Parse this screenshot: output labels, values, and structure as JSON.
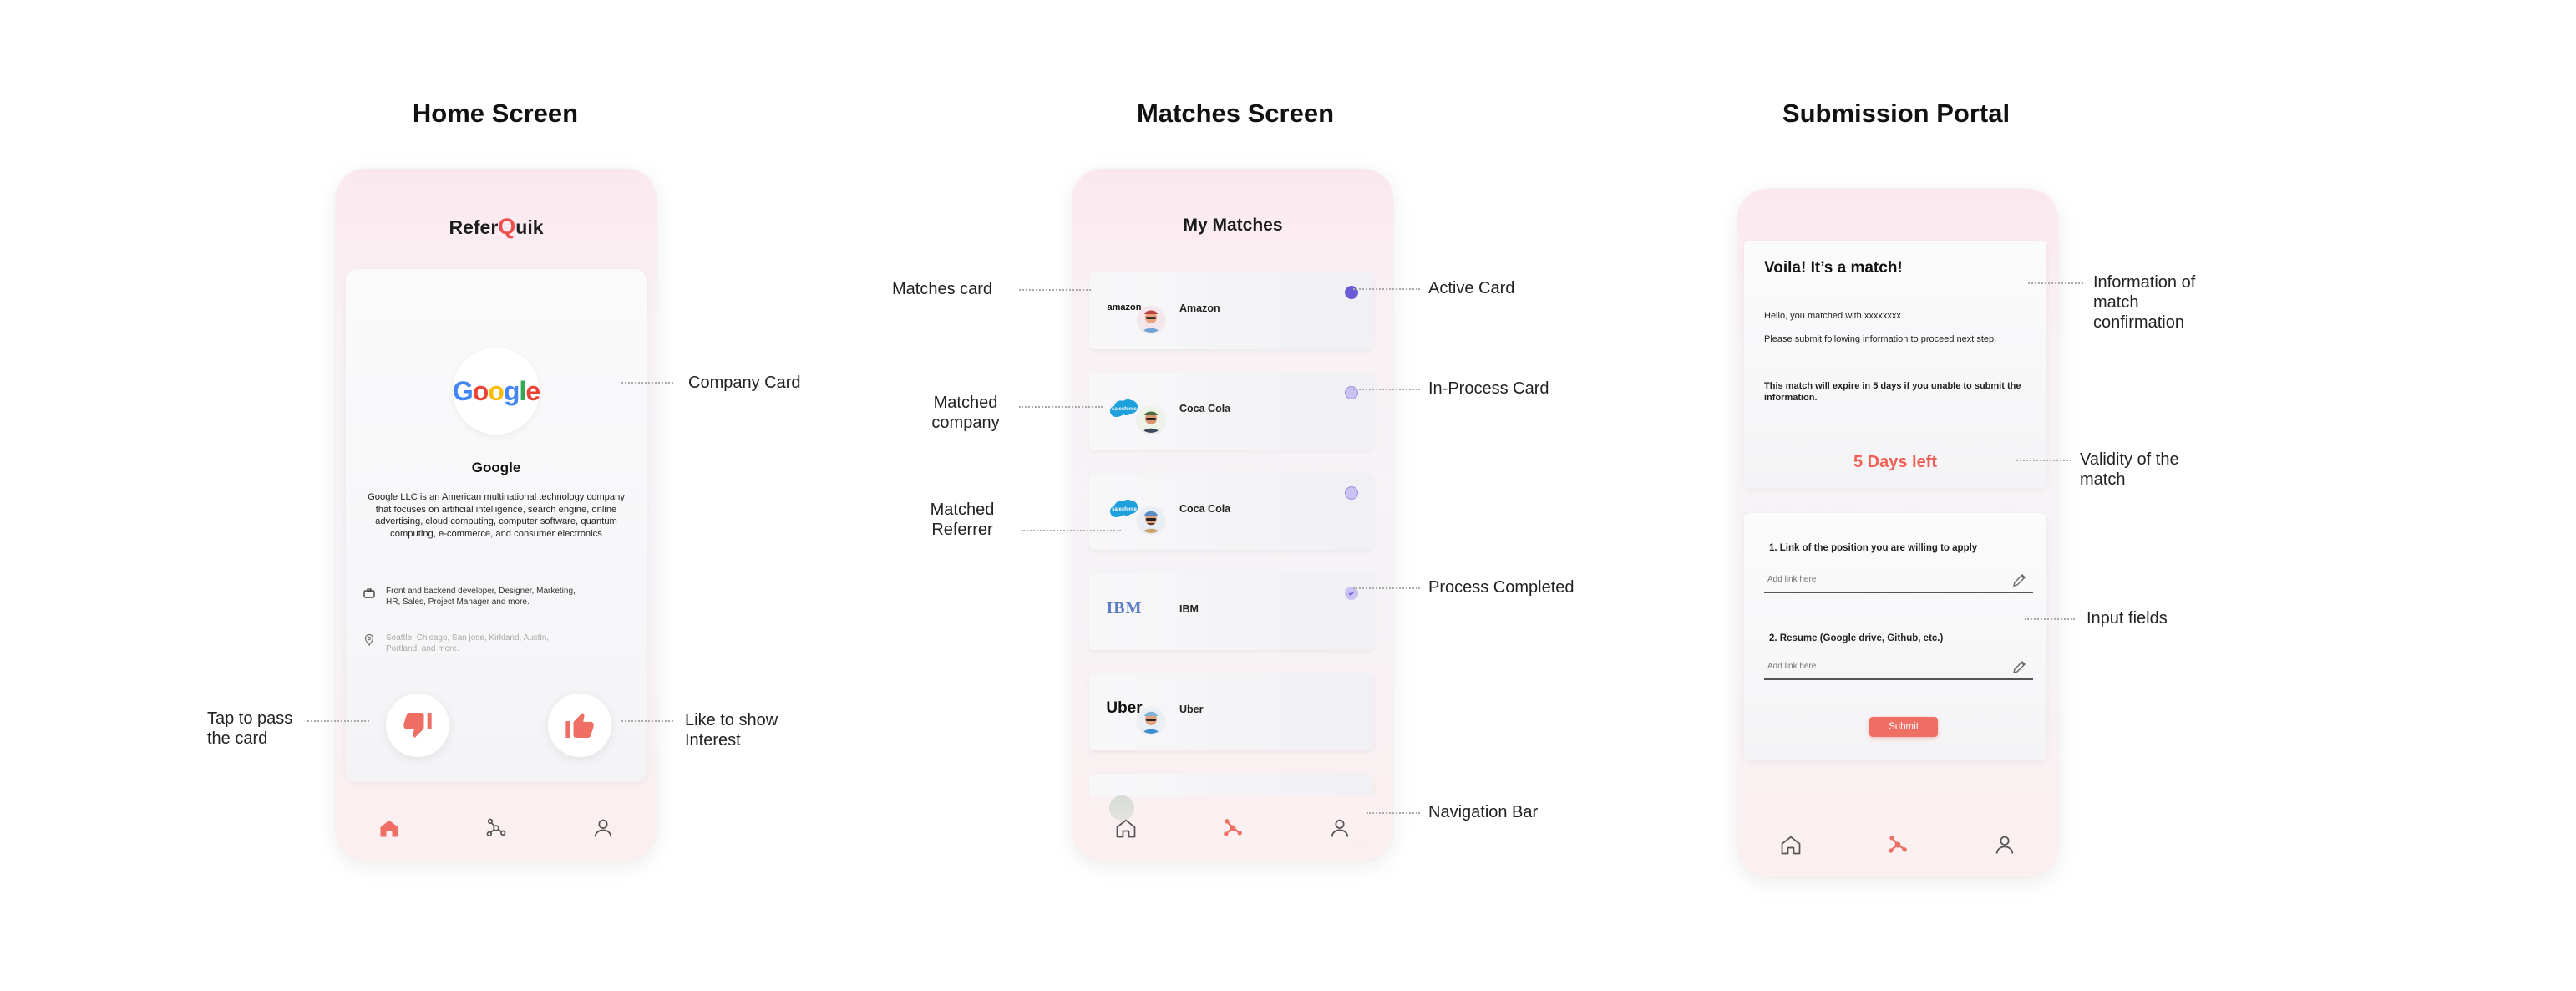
{
  "titles": {
    "home": "Home Screen",
    "matches": "Matches Screen",
    "submission": "Submission Portal"
  },
  "home": {
    "logo_prefix": "Refer",
    "logo_q": "Q",
    "logo_suffix": "uik",
    "company_name": "Google",
    "logo_text": "Google",
    "description": "Google LLC is an American multinational technology company that focuses on artificial intelligence, search engine, online advertising, cloud computing, computer software, quantum computing, e-commerce, and consumer electronics",
    "roles": "Front and backend developer, Designer, Marketing, HR, Sales, Project Manager and more.",
    "locations": "Seattle, Chicago, San jose, Kirkland, Austin, Portland, and more.",
    "annotations": {
      "company_card": "Company Card",
      "pass": "Tap to pass the card",
      "like": "Like to show Interest"
    }
  },
  "matches": {
    "title": "My Matches",
    "cards": [
      {
        "company": "Amazon",
        "logo": "amazon",
        "status": "active"
      },
      {
        "company": "Coca Cola",
        "logo": "salesforce",
        "status": "in-process"
      },
      {
        "company": "Coca Cola",
        "logo": "salesforce",
        "status": "in-process"
      },
      {
        "company": "IBM",
        "logo": "IBM",
        "status": "completed"
      },
      {
        "company": "Uber",
        "logo": "Uber",
        "status": "none"
      }
    ],
    "annotations": {
      "matches_card": "Matches card",
      "matched_company": "Matched company",
      "matched_referrer": "Matched Referrer",
      "active_card": "Active Card",
      "in_process_card": "In-Process Card",
      "process_completed": "Process Completed",
      "navigation_bar": "Navigation Bar"
    },
    "colors": {
      "active": "#6a5cd6",
      "in_process": "#c9c2f2",
      "completed": "#c9c2f2"
    }
  },
  "submission": {
    "title": "Voila! It’s a match!",
    "hello": "Hello, you matched with xxxxxxxx",
    "instruction": "Please submit following information to proceed next step.",
    "warning": "This match will expire in 5 days if you unable to submit the information.",
    "days_left": "5 Days left",
    "q1": "1.  Link of the position you are willing to apply",
    "q2": "2.  Resume (Google drive, Github, etc.)",
    "placeholder1": "Add link here",
    "placeholder2": "Add link here",
    "submit": "Submit",
    "annotations": {
      "info": "Information of match confirmation",
      "validity": "Validity of the match",
      "inputs": "Input fields"
    }
  },
  "accent_color": "#ef6f64"
}
